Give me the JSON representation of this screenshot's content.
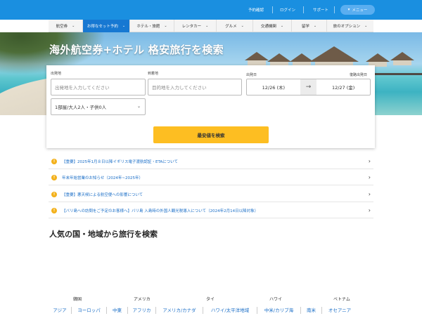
{
  "topbar": {
    "links": [
      "予約確認",
      "ログイン",
      "サポート"
    ],
    "menu_label": "メニュー",
    "menu_icon": "chevron-down-icon"
  },
  "nav": {
    "items": [
      {
        "label": "航空券",
        "active": false
      },
      {
        "label": "お得なセット予約",
        "active": true
      },
      {
        "label": "ホテル・旅館",
        "active": false
      },
      {
        "label": "レンタカー",
        "active": false
      },
      {
        "label": "グルメ",
        "active": false
      },
      {
        "label": "交通機関",
        "active": false
      },
      {
        "label": "留学",
        "active": false
      },
      {
        "label": "旅のオプション",
        "active": false
      }
    ]
  },
  "hero": {
    "title": "海外航空券+ホテル 格安旅行を検索"
  },
  "search": {
    "origin_label": "出発地",
    "origin_placeholder": "出発地を入力してください",
    "destination_label": "到着地",
    "destination_placeholder": "目的地を入力してください",
    "depart_label": "出発日",
    "return_label": "復路出発日",
    "depart_value": "12/26 (木)",
    "return_value": "12/27 (金)",
    "guests_value": "1部屋/大人2人・子供0人",
    "submit_label": "最安値を検索",
    "accent_color": "#fdbe22"
  },
  "notices": [
    "【重要】2025年1月８日以降イギリス電子渡航認証・ETAについて",
    "年末年始営業のお知らせ（2024年~2025年）",
    "【重要】悪天候による航空便への影響について",
    "【バリ島への訪問をご予定のお客様へ】バリ島 入島時の外国人観光税導入について（2024年2月14日以降対象）"
  ],
  "popular": {
    "title": "人気の国・地域から旅行を検索",
    "countries": [
      "韓国",
      "アメリカ",
      "タイ",
      "ハワイ",
      "ベトナム"
    ],
    "regions": [
      "アジア",
      "ヨーロッパ",
      "中東",
      "アフリカ",
      "アメリカ/カナダ",
      "ハワイ/太平洋地域",
      "中米/カリブ海",
      "南米",
      "オセアニア"
    ]
  },
  "colors": {
    "topbar": "#1a8fe0",
    "nav_active": "#1778d2",
    "link": "#1a6ec7",
    "warning": "#f3b11b"
  }
}
